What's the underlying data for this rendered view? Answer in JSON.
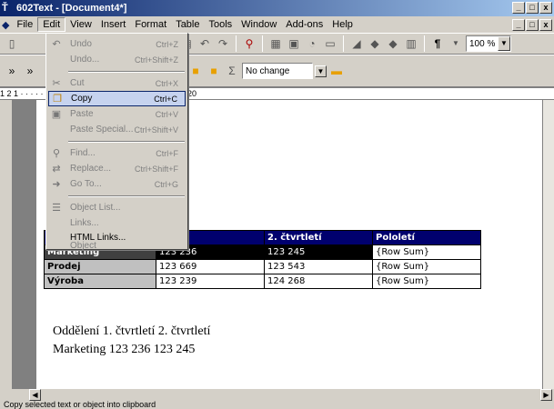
{
  "window": {
    "title": "602Text - [Document4*]",
    "buttons": [
      "_",
      "□",
      "x"
    ]
  },
  "menubar": {
    "items": [
      "File",
      "Edit",
      "View",
      "Insert",
      "Format",
      "Table",
      "Tools",
      "Window",
      "Add-ons",
      "Help"
    ]
  },
  "toolbar": {
    "zoom": "100 %",
    "style_combo": "No change"
  },
  "ruler": {
    "text": "1  2  1  ·  ·  ·  ·  ·  ·  ·  ·  9  1  10  11  12  13  14  15  16  17  18  19  20"
  },
  "edit_menu": {
    "items": [
      {
        "label": "Undo",
        "shortcut": "Ctrl+Z",
        "icon": "undo-icon",
        "disabled": true
      },
      {
        "label": "Undo...",
        "shortcut": "Ctrl+Shift+Z",
        "icon": "",
        "disabled": true
      },
      {
        "label": "Cut",
        "shortcut": "Ctrl+X",
        "icon": "scissors-icon",
        "disabled": true
      },
      {
        "label": "Copy",
        "shortcut": "Ctrl+C",
        "icon": "copy-icon",
        "disabled": false,
        "highlighted": true
      },
      {
        "label": "Paste",
        "shortcut": "Ctrl+V",
        "icon": "paste-icon",
        "disabled": true
      },
      {
        "label": "Paste Special...",
        "shortcut": "Ctrl+Shift+V",
        "icon": "",
        "disabled": true
      },
      {
        "label": "Find...",
        "shortcut": "Ctrl+F",
        "icon": "find-icon",
        "disabled": true
      },
      {
        "label": "Replace...",
        "shortcut": "Ctrl+Shift+F",
        "icon": "replace-icon",
        "disabled": true
      },
      {
        "label": "Go To...",
        "shortcut": "Ctrl+G",
        "icon": "goto-icon",
        "disabled": true
      },
      {
        "label": "Object List...",
        "shortcut": "",
        "icon": "object-list-icon",
        "disabled": true
      },
      {
        "label": "Links...",
        "shortcut": "",
        "icon": "",
        "disabled": true
      },
      {
        "label": "HTML Links...",
        "shortcut": "",
        "icon": "",
        "disabled": false
      },
      {
        "label": "Object",
        "shortcut": "",
        "icon": "",
        "disabled": true
      }
    ]
  },
  "table": {
    "header": [
      "",
      "ctletí",
      "2. čtvrtletí",
      "Pololetí"
    ],
    "rows": [
      [
        "Marketing",
        "123 236",
        "123 245",
        "{Row Sum}"
      ],
      [
        "Prodej",
        "123 669",
        "123 543",
        "{Row Sum}"
      ],
      [
        "Výroba",
        "123 239",
        "124 268",
        "{Row Sum}"
      ]
    ]
  },
  "plain_text": {
    "line1": "Oddělení   1. čtvrtletí 2. čtvrtletí",
    "line2": "Marketing 123 236    123 245"
  },
  "status": {
    "text": "Copy selected text or object into clipboard"
  },
  "colors": {
    "title_start": "#0a246a",
    "table_header": "#00006e",
    "menu_highlight": "#c6d3ef"
  }
}
